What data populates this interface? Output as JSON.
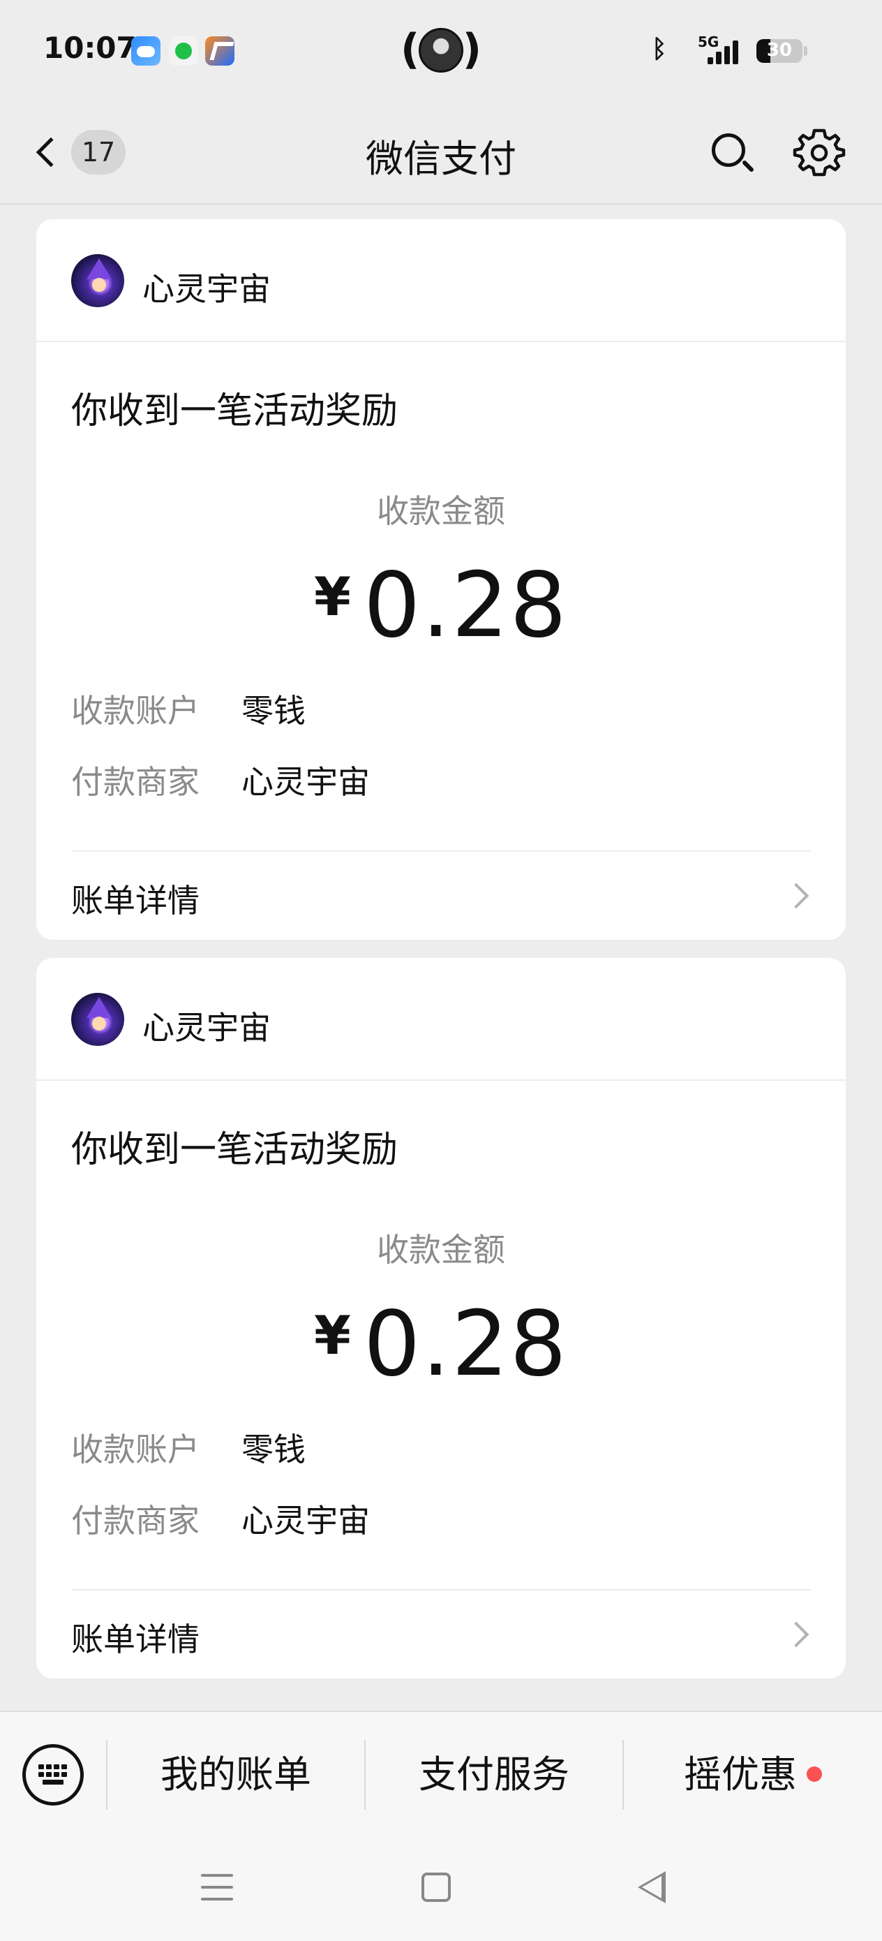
{
  "status_bar": {
    "time": "10:07",
    "network": "5G",
    "battery_text": "30",
    "battery_level": 0.3,
    "icons": [
      "weather-app-icon",
      "music-app-icon",
      "travel-app-icon",
      "bluetooth-icon",
      "signal-icon",
      "battery-icon"
    ]
  },
  "nav": {
    "unread_count": "17",
    "title": "微信支付",
    "icons": [
      "back-chevron-icon",
      "search-icon",
      "gear-icon"
    ]
  },
  "cards": [
    {
      "merchant_name": "心灵宇宙",
      "notice_title": "你收到一笔活动奖励",
      "amount_label": "收款金额",
      "currency": "¥",
      "amount": "0.28",
      "fields": [
        {
          "label": "收款账户",
          "value": "零钱"
        },
        {
          "label": "付款商家",
          "value": "心灵宇宙"
        }
      ],
      "detail_link": "账单详情"
    },
    {
      "merchant_name": "心灵宇宙",
      "notice_title": "你收到一笔活动奖励",
      "amount_label": "收款金额",
      "currency": "¥",
      "amount": "0.28",
      "fields": [
        {
          "label": "收款账户",
          "value": "零钱"
        },
        {
          "label": "付款商家",
          "value": "心灵宇宙"
        }
      ],
      "detail_link": "账单详情"
    }
  ],
  "bottom_menu": {
    "items": [
      {
        "label": "我的账单"
      },
      {
        "label": "支付服务"
      },
      {
        "label": "摇优惠",
        "has_red_dot": true
      }
    ],
    "keyboard_icon": "keyboard-icon"
  },
  "colors": {
    "page_background": "#ededed",
    "card_background": "#ffffff",
    "muted_text": "#8a8a8a",
    "red_dot": "#fa5151"
  }
}
